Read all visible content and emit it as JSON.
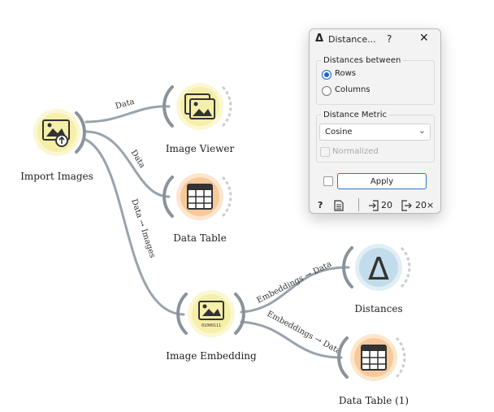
{
  "workflow": {
    "nodes": [
      {
        "id": "import_images",
        "label": "Import Images",
        "icon": "import-images-icon"
      },
      {
        "id": "image_viewer",
        "label": "Image Viewer",
        "icon": "image-viewer-icon"
      },
      {
        "id": "data_table",
        "label": "Data Table",
        "icon": "table-icon"
      },
      {
        "id": "image_embedding",
        "label": "Image Embedding",
        "icon": "image-embedding-icon",
        "icon_caption": "01000111"
      },
      {
        "id": "distances",
        "label": "Distances",
        "icon": "delta-icon",
        "icon_glyph": "Δ"
      },
      {
        "id": "data_table_1",
        "label": "Data Table (1)",
        "icon": "table-icon"
      }
    ],
    "links": [
      {
        "from": "import_images",
        "to": "image_viewer",
        "label": "Data"
      },
      {
        "from": "import_images",
        "to": "data_table",
        "label": "Data"
      },
      {
        "from": "import_images",
        "to": "image_embedding",
        "label": "Data → Images"
      },
      {
        "from": "image_embedding",
        "to": "distances",
        "label": "Embeddings → Data"
      },
      {
        "from": "image_embedding",
        "to": "data_table_1",
        "label": "Embeddings → Data"
      }
    ],
    "colors": {
      "yellow_fill": "#f6efa9",
      "yellow_ring": "#fbf7d2",
      "orange_fill": "#f7c99a",
      "orange_ring": "#fde6cc",
      "blue_fill": "#c3dcec",
      "blue_ring": "#e2eef6",
      "connector": "#8a939c",
      "link": "#9aa3ab"
    }
  },
  "dialog": {
    "title": "Distance...",
    "title_icon": "Δ",
    "help_glyph": "?",
    "close_glyph": "✕",
    "distances_between": {
      "legend": "Distances between",
      "options": [
        {
          "label": "Rows",
          "checked": true
        },
        {
          "label": "Columns",
          "checked": false
        }
      ]
    },
    "distance_metric": {
      "legend": "Distance Metric",
      "selected": "Cosine",
      "normalized_label": "Normalized",
      "normalized_checked": false,
      "normalized_enabled": false
    },
    "auto_apply_checked": false,
    "apply_label": "Apply",
    "status": {
      "help_glyph": "?",
      "input_count": "20",
      "output_count": "20×"
    }
  }
}
